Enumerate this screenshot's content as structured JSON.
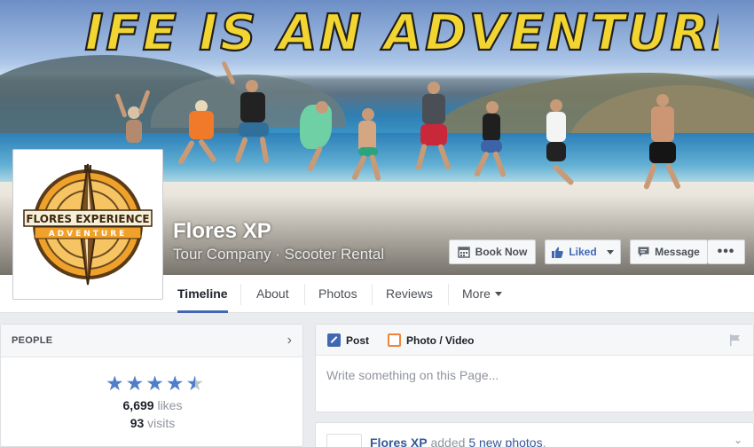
{
  "cover": {
    "headline": "LIFE IS AN ADVENTURE"
  },
  "page": {
    "name": "Flores XP",
    "category": "Tour Company · Scooter Rental",
    "logo_text_top": "FLORES EXPERIENCE",
    "logo_text_bottom": "ADVENTURE"
  },
  "actions": {
    "book_now": "Book Now",
    "liked": "Liked",
    "message": "Message",
    "more": "•••"
  },
  "tabs": [
    {
      "label": "Timeline",
      "active": true
    },
    {
      "label": "About"
    },
    {
      "label": "Photos"
    },
    {
      "label": "Reviews"
    },
    {
      "label": "More"
    }
  ],
  "people": {
    "title": "PEOPLE",
    "rating": 4.5,
    "likes_count": "6,699",
    "likes_label": "likes",
    "visits_count": "93",
    "visits_label": "visits"
  },
  "composer": {
    "post_label": "Post",
    "photo_label": "Photo / Video",
    "placeholder": "Write something on this Page..."
  },
  "feed": {
    "author": "Flores XP",
    "action": "added",
    "link": "5 new photos",
    "suffix": "."
  },
  "colors": {
    "accent": "#4267b2",
    "star": "#4f7fcb",
    "headline_fill": "#f2d531"
  }
}
